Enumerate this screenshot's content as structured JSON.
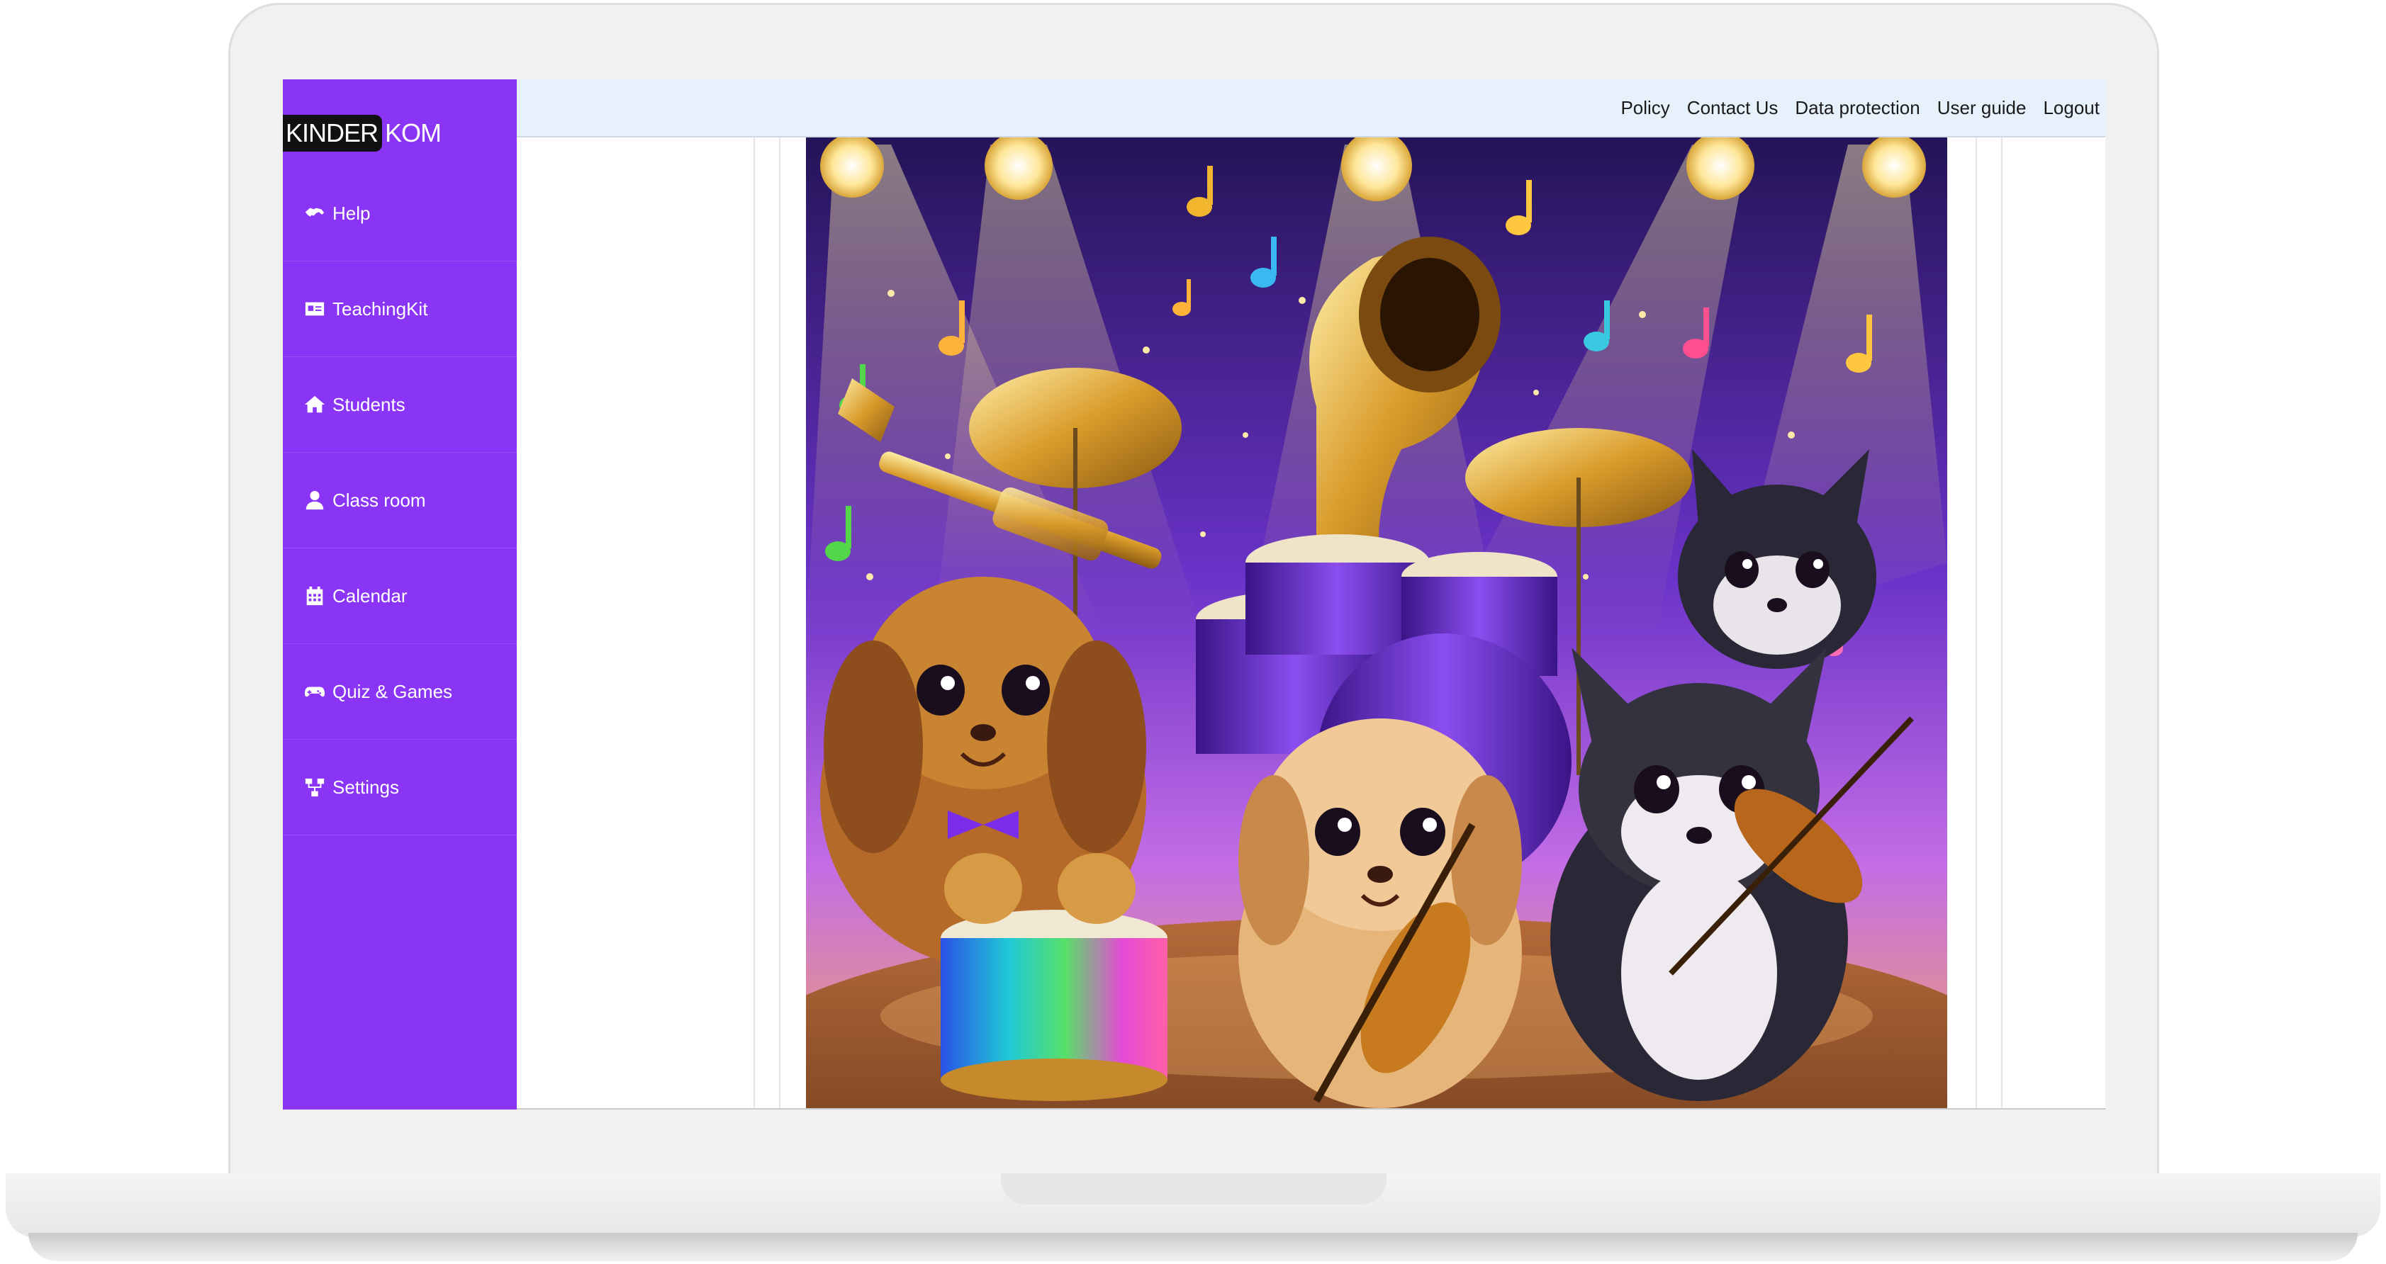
{
  "brand": {
    "logo_dark": "KINDER",
    "logo_rest": "KOM"
  },
  "sidebar": {
    "items": [
      {
        "label": "Help",
        "icon": "handshake-icon"
      },
      {
        "label": "TeachingKit",
        "icon": "id-card-icon"
      },
      {
        "label": "Students",
        "icon": "home-icon"
      },
      {
        "label": "Class room",
        "icon": "user-icon"
      },
      {
        "label": "Calendar",
        "icon": "calendar-icon"
      },
      {
        "label": "Quiz & Games",
        "icon": "gamepad-icon"
      },
      {
        "label": "Settings",
        "icon": "sitemap-icon"
      }
    ]
  },
  "topnav": {
    "links": [
      "Policy",
      "Contact Us",
      "Data protection",
      "User guide",
      "Logout"
    ]
  },
  "colors": {
    "sidebar": "#8a35f6",
    "topbar": "#e6f1fc",
    "stage_sky": "#5b2bbf",
    "stage_glow": "#e79bf4"
  }
}
